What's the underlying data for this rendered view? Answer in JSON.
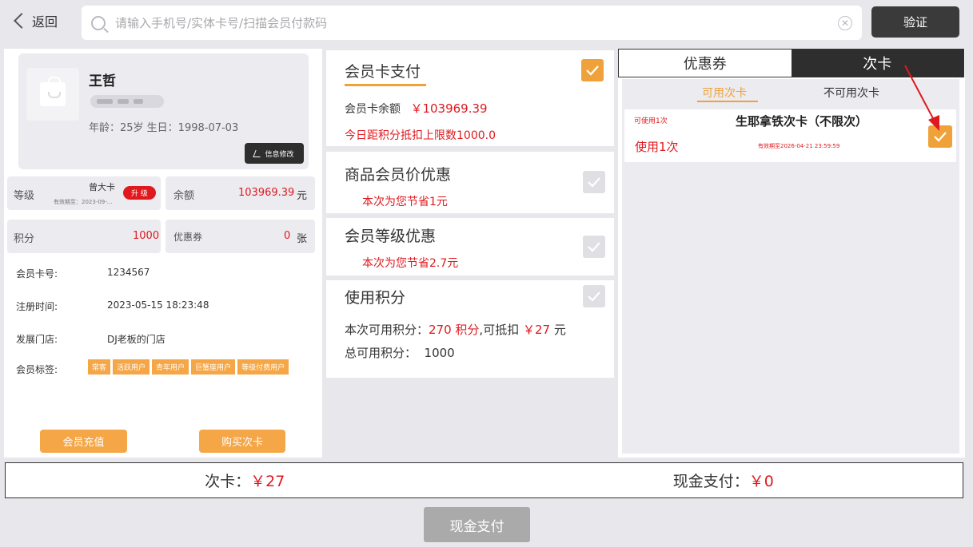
{
  "header": {
    "back_label": "返回",
    "search_placeholder": "请输入手机号/实体卡号/扫描会员付款码",
    "verify_label": "验证"
  },
  "member": {
    "name": "王哲",
    "age_birthday": "年龄：25岁  生日：1998-07-03",
    "edit_label": "信息修改",
    "level_label": "等级",
    "level_name": "曾大卡",
    "level_validity": "有效期至：2023-09-...",
    "upgrade_label": "升 级",
    "balance_label": "余额",
    "balance_value": "103969.39",
    "balance_unit": "元",
    "points_label": "积分",
    "points_value": "1000",
    "coupon_label": "优惠券",
    "coupon_value": "0",
    "coupon_unit": "张",
    "card_no_label": "会员卡号:",
    "card_no": "1234567",
    "reg_label": "注册时间:",
    "reg_time": "2023-05-15 18:23:48",
    "store_label": "发展门店:",
    "store": "DJ老板的门店",
    "tags_label": "会员标签:",
    "tags": [
      "常客",
      "活跃用户",
      "青年用户",
      "巨蟹座用户",
      "等级付费用户"
    ],
    "recharge_label": "会员充值",
    "buy_card_label": "购买次卡"
  },
  "payment": {
    "card_pay": {
      "title": "会员卡支付",
      "balance_text": "会员卡余额",
      "balance_value": "￥103969.39",
      "limit_text": "今日距积分抵扣上限数1000.0",
      "checked": true
    },
    "product_discount": {
      "title": "商品会员价优惠",
      "saving": "本次为您节省1元",
      "checked": false
    },
    "level_discount": {
      "title": "会员等级优惠",
      "saving": "本次为您节省2.7元",
      "checked": false
    },
    "use_points": {
      "title": "使用积分",
      "avail_prefix": "本次可用积分：",
      "avail_points": "270 积分",
      "deduct_prefix": ",可抵扣",
      "deduct_value": "￥27",
      "deduct_unit": "元",
      "total_text": "总可用积分：  1000",
      "checked": false
    }
  },
  "right_panel": {
    "tab_coupon": "优惠券",
    "tab_times_card": "次卡",
    "sub_tab_available": "可用次卡",
    "sub_tab_unavailable": "不可用次卡",
    "item": {
      "usable_text": "可使用1次",
      "name": "生耶拿铁次卡（不限次）",
      "use_text": "使用1次",
      "validity": "有效期至2026-04-21 23:59:59",
      "checked": true
    }
  },
  "footer": {
    "times_card_label": "次卡：",
    "times_card_value": "￥27",
    "cash_label": "现金支付：",
    "cash_value": "￥0",
    "cash_button": "现金支付"
  },
  "colors": {
    "accent_orange": "#f0a23a",
    "price_red": "#e0191e",
    "dark": "#2e2e2e"
  }
}
